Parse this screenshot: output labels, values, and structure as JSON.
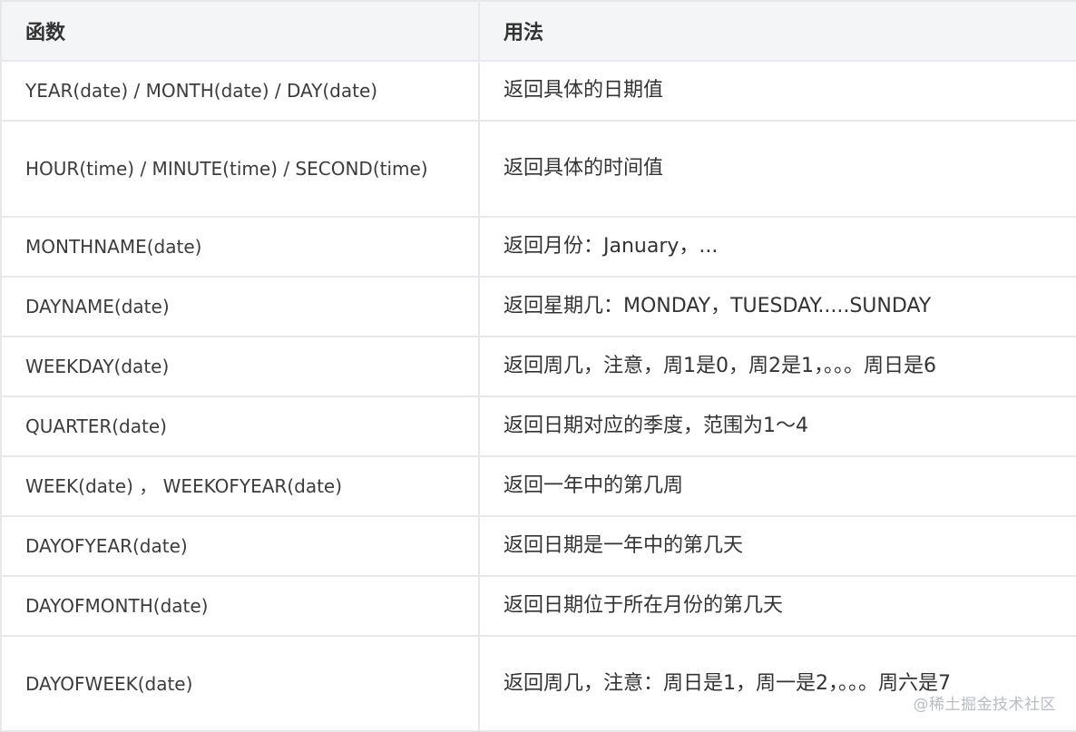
{
  "table": {
    "headers": [
      "函数",
      "用法"
    ],
    "rows": [
      {
        "func": "YEAR(date) / MONTH(date) / DAY(date)",
        "usage": "返回具体的日期值"
      },
      {
        "func": "HOUR(time) / MINUTE(time) / SECOND(time)",
        "usage": "返回具体的时间值"
      },
      {
        "func": "MONTHNAME(date)",
        "usage": "返回月份：January，..."
      },
      {
        "func": "DAYNAME(date)",
        "usage": "返回星期几：MONDAY，TUESDAY.....SUNDAY"
      },
      {
        "func": "WEEKDAY(date)",
        "usage": "返回周几，注意，周1是0，周2是1，。。。周日是6"
      },
      {
        "func": "QUARTER(date)",
        "usage": "返回日期对应的季度，范围为1～4"
      },
      {
        "func": "WEEK(date) ， WEEKOFYEAR(date)",
        "usage": "返回一年中的第几周"
      },
      {
        "func": "DAYOFYEAR(date)",
        "usage": "返回日期是一年中的第几天"
      },
      {
        "func": "DAYOFMONTH(date)",
        "usage": "返回日期位于所在月份的第几天"
      },
      {
        "func": "DAYOFWEEK(date)",
        "usage": "返回周几，注意：周日是1，周一是2，。。。周六是7"
      }
    ]
  },
  "watermark": "@稀土掘金技术社区"
}
